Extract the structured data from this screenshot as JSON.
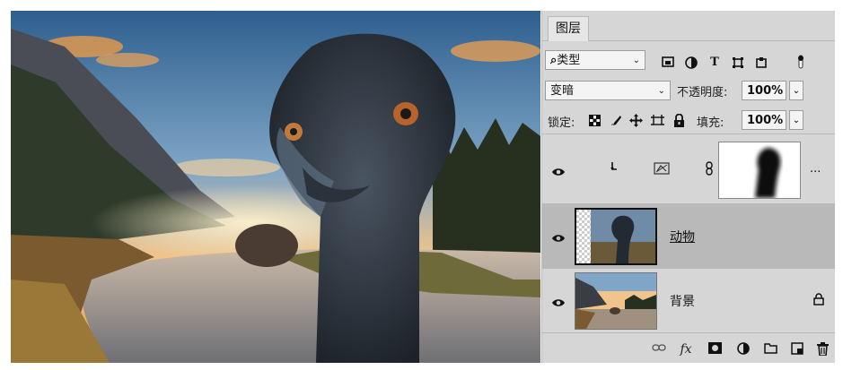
{
  "panel": {
    "tab_label": "图层",
    "filter": {
      "label": "类型",
      "search_icon": "search-icon"
    },
    "blend_mode": "变暗",
    "opacity_label": "不透明度:",
    "opacity_value": "100%",
    "lock_label": "锁定:",
    "fill_label": "填充:",
    "fill_value": "100%"
  },
  "layers": [
    {
      "name": "",
      "type": "adjustment-mask",
      "more": "..."
    },
    {
      "name": "动物",
      "selected": true
    },
    {
      "name": "背景",
      "locked": true
    }
  ],
  "bottom": {
    "fx_label": "fx"
  },
  "colors": {
    "panel_bg": "#d6d6d6",
    "selected_layer": "#b9b9b9"
  }
}
